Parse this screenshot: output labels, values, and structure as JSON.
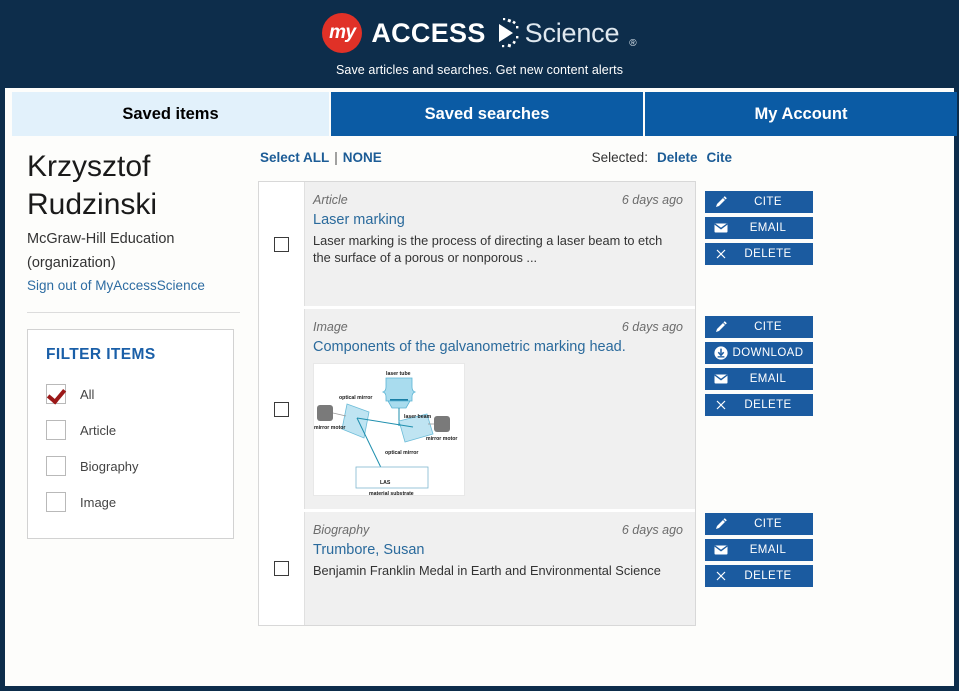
{
  "brand": {
    "my": "my",
    "access": "Access",
    "science": "Science",
    "registered": "®",
    "tagline": "Save articles and searches. Get new content alerts",
    "accent_red": "#e03127",
    "navy": "#0d2d4b",
    "blue": "#0b5ba4"
  },
  "tabs": [
    {
      "label": "Saved items",
      "active": true
    },
    {
      "label": "Saved searches",
      "active": false
    },
    {
      "label": "My Account",
      "active": false
    }
  ],
  "sidebar": {
    "user_name": "Krzysztof Rudzinski",
    "organization": "McGraw-Hill Education (organization)",
    "signout_label": "Sign out of MyAccessScience",
    "filter": {
      "title": "FILTER ITEMS",
      "options": [
        {
          "label": "All",
          "checked": true
        },
        {
          "label": "Article",
          "checked": false
        },
        {
          "label": "Biography",
          "checked": false
        },
        {
          "label": "Image",
          "checked": false
        }
      ]
    }
  },
  "toolbar": {
    "select_label": "Select ALL",
    "pipe": "|",
    "none_label": "NONE",
    "selected_label": "Selected:",
    "delete_label": "Delete",
    "cite_label": "Cite"
  },
  "items": [
    {
      "type": "Article",
      "time": "6 days ago",
      "title": "Laser marking",
      "description": "Laser marking is the process of directing a laser beam to etch the surface of a porous or nonporous ...",
      "actions": [
        "CITE",
        "EMAIL",
        "DELETE"
      ]
    },
    {
      "type": "Image",
      "time": "6 days ago",
      "title": "Components of the galvanometric marking head.",
      "description": "",
      "actions": [
        "CITE",
        "DOWNLOAD",
        "EMAIL",
        "DELETE"
      ],
      "thumbnail_labels": {
        "laser_tube": "laser tube",
        "laser_beam": "laser beam",
        "optical_mirror_left": "optical mirror",
        "optical_mirror_right": "optical mirror",
        "mirror_motor_left": "mirror motor",
        "mirror_motor_right": "mirror motor",
        "las": "LAS",
        "material_substrate": "material substrate"
      }
    },
    {
      "type": "Biography",
      "time": "6 days ago",
      "title": "Trumbore, Susan",
      "description": "Benjamin Franklin Medal in Earth and Environmental Science",
      "actions": [
        "CITE",
        "EMAIL",
        "DELETE"
      ]
    }
  ]
}
